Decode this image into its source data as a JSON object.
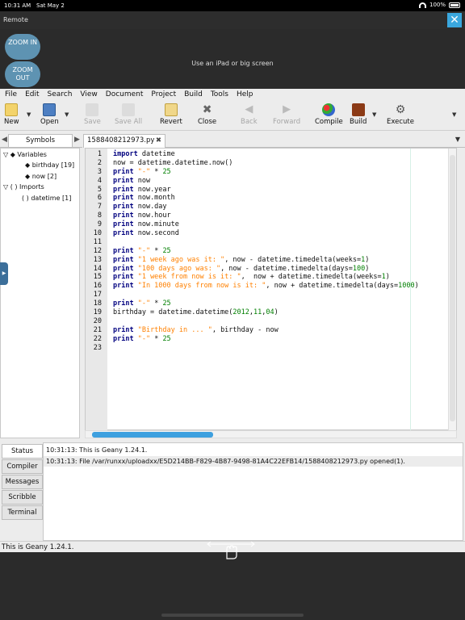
{
  "ios_status": {
    "time": "10:31 AM",
    "date": "Sat May 2",
    "battery": "100%"
  },
  "remote": {
    "title": "Remote",
    "close_label": "✕",
    "zoom_in": "ZOOM IN",
    "zoom_out": "ZOOM OUT",
    "hint": "Use an iPad or big screen"
  },
  "menu": [
    "File",
    "Edit",
    "Search",
    "View",
    "Document",
    "Project",
    "Build",
    "Tools",
    "Help"
  ],
  "toolbar": {
    "new": "New",
    "open": "Open",
    "save": "Save",
    "save_all": "Save All",
    "revert": "Revert",
    "close": "Close",
    "back": "Back",
    "forward": "Forward",
    "compile": "Compile",
    "build": "Build",
    "execute": "Execute"
  },
  "sidebar": {
    "tab": "Symbols",
    "tree": {
      "variables": "Variables",
      "birthday": "birthday [19]",
      "now": "now [2]",
      "imports": "Imports",
      "datetime": "datetime [1]"
    }
  },
  "editor": {
    "filename": "1588408212973.py",
    "line_numbers": [
      "1",
      "2",
      "3",
      "4",
      "5",
      "6",
      "7",
      "8",
      "9",
      "10",
      "11",
      "12",
      "13",
      "14",
      "15",
      "16",
      "17",
      "18",
      "19",
      "20",
      "21",
      "22",
      "23"
    ],
    "lines": {
      "l1a": "import",
      "l1b": " datetime",
      "l2": "now = datetime.datetime.now()",
      "l3a": "print",
      "l3b": " \"-\"",
      "l3c": " * ",
      "l3d": "25",
      "l4a": "print",
      "l4b": " now",
      "l5a": "print",
      "l5b": " now.year",
      "l6a": "print",
      "l6b": " now.month",
      "l7a": "print",
      "l7b": " now.day",
      "l8a": "print",
      "l8b": " now.hour",
      "l9a": "print",
      "l9b": " now.minute",
      "l10a": "print",
      "l10b": " now.second",
      "l12a": "print",
      "l12b": " \"-\"",
      "l12c": " * ",
      "l12d": "25",
      "l13a": "print",
      "l13b": " \"1 week ago was it: \"",
      "l13c": ", now - datetime.timedelta(weeks=",
      "l13d": "1",
      "l13e": ")",
      "l14a": "print",
      "l14b": " \"100 days ago was: \"",
      "l14c": ", now - datetime.timedelta(days=",
      "l14d": "100",
      "l14e": ")",
      "l15a": "print",
      "l15b": " \"1 week from now is it: \"",
      "l15c": ",  now + datetime.timedelta(weeks=",
      "l15d": "1",
      "l15e": ")",
      "l16a": "print",
      "l16b": " \"In 1000 days from now is it: \"",
      "l16c": ", now + datetime.timedelta(days=",
      "l16d": "1000",
      "l16e": ")",
      "l18a": "print",
      "l18b": " \"-\"",
      "l18c": " * ",
      "l18d": "25",
      "l19a": "birthday = datetime.datetime(",
      "l19b": "2012",
      "l19c": ",",
      "l19d": "11",
      "l19e": ",",
      "l19f": "04",
      "l19g": ")",
      "l21a": "print",
      "l21b": " \"Birthday in ... \"",
      "l21c": ", birthday - now",
      "l22a": "print",
      "l22b": " \"-\"",
      "l22c": " * ",
      "l22d": "25"
    }
  },
  "messages": {
    "tabs": [
      "Status",
      "Compiler",
      "Messages",
      "Scribble",
      "Terminal"
    ],
    "rows": [
      "10:31:13: This is Geany 1.24.1.",
      "10:31:13: File /var/runxx/uploadxx/E5D214BB-F829-4B87-9498-81A4C22EFB14/1588408212973.py opened(1)."
    ]
  },
  "statusbar": "This is Geany 1.24.1.",
  "colors": {
    "accent": "#3aa7de",
    "zoom_button": "#5e93b2",
    "keyword": "#00007f",
    "string": "#ff8000",
    "number": "#007f00"
  }
}
